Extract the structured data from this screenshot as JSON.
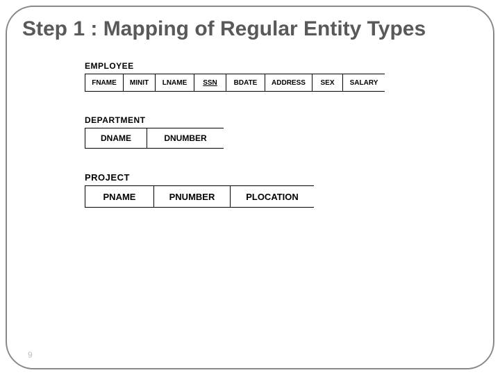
{
  "slide": {
    "title": "Step 1 : Mapping of Regular Entity Types",
    "page_number": "9"
  },
  "entities": {
    "employee": {
      "name": "EMPLOYEE",
      "cols": [
        "FNAME",
        "MINIT",
        "LNAME",
        "SSN",
        "BDATE",
        "ADDRESS",
        "SEX",
        "SALARY"
      ],
      "underline_index": 3
    },
    "department": {
      "name": "DEPARTMENT",
      "cols": [
        "DNAME",
        "DNUMBER"
      ]
    },
    "project": {
      "name": "PROJECT",
      "cols": [
        "PNAME",
        "PNUMBER",
        "PLOCATION"
      ]
    }
  }
}
